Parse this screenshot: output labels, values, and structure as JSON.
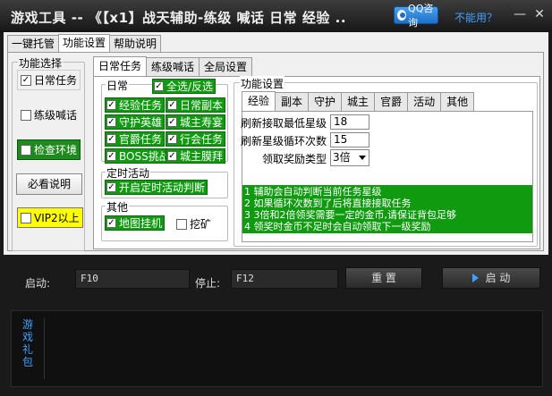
{
  "window": {
    "title": "游戏工具 -- 《【x1】战天辅助-练级 喊话 日常 经验 ..",
    "qq_button": "QQ咨询",
    "cant_use_link": "不能用？",
    "minimize": "—",
    "close": "✕"
  },
  "outer_tabs": [
    "一键托管",
    "功能设置",
    "帮助说明"
  ],
  "left_panel": {
    "legend": "功能选择",
    "daily_task": "日常任务",
    "level_shout": "练级喊话",
    "check_env": "检查环境",
    "must_read": "必看说明",
    "vip": "VIP2以上"
  },
  "inner_tabs": [
    "日常任务",
    "练级喊话",
    "全局设置"
  ],
  "daily": {
    "legend": "日常",
    "select_all": "全选/反选",
    "items": [
      "经验任务",
      "日常副本",
      "守护英雄",
      "城主寿宴",
      "官爵任务",
      "行会任务",
      "BOSS挑战",
      "城主膜拜"
    ]
  },
  "timed": {
    "legend": "定时活动",
    "item": "开启定时活动判断"
  },
  "other": {
    "legend": "其他",
    "map_hang": "地图挂机",
    "dig": "挖矿"
  },
  "func_settings": {
    "legend": "功能设置",
    "tabs": [
      "经验",
      "副本",
      "守护",
      "城主",
      "官爵",
      "活动",
      "其他"
    ],
    "refresh_min_star_label": "刷新接取最低星级",
    "refresh_min_star_value": "18",
    "refresh_loop_label": "刷新星级循环次数",
    "refresh_loop_value": "15",
    "reward_type_label": "领取奖励类型",
    "reward_type_value": "3倍",
    "notes": [
      "1 辅助会自动判断当前任务星级",
      "2 如果循环次数到了后将直接接取任务",
      "3 3倍和2倍领奖需要一定的金币,请保证背包足够",
      "4 领奖时金币不足时会自动领取下一级奖励"
    ]
  },
  "controls": {
    "start_label": "启动:",
    "start_key": "F10",
    "stop_label": "停止:",
    "stop_key": "F12",
    "reset_button": "重 置",
    "start_button": "启 动"
  },
  "gift": {
    "text": "游戏礼包"
  },
  "colors": {
    "accent_green": "#0f9a0f",
    "link_blue": "#3fa2ff",
    "vip_yellow": "#ffff00"
  }
}
